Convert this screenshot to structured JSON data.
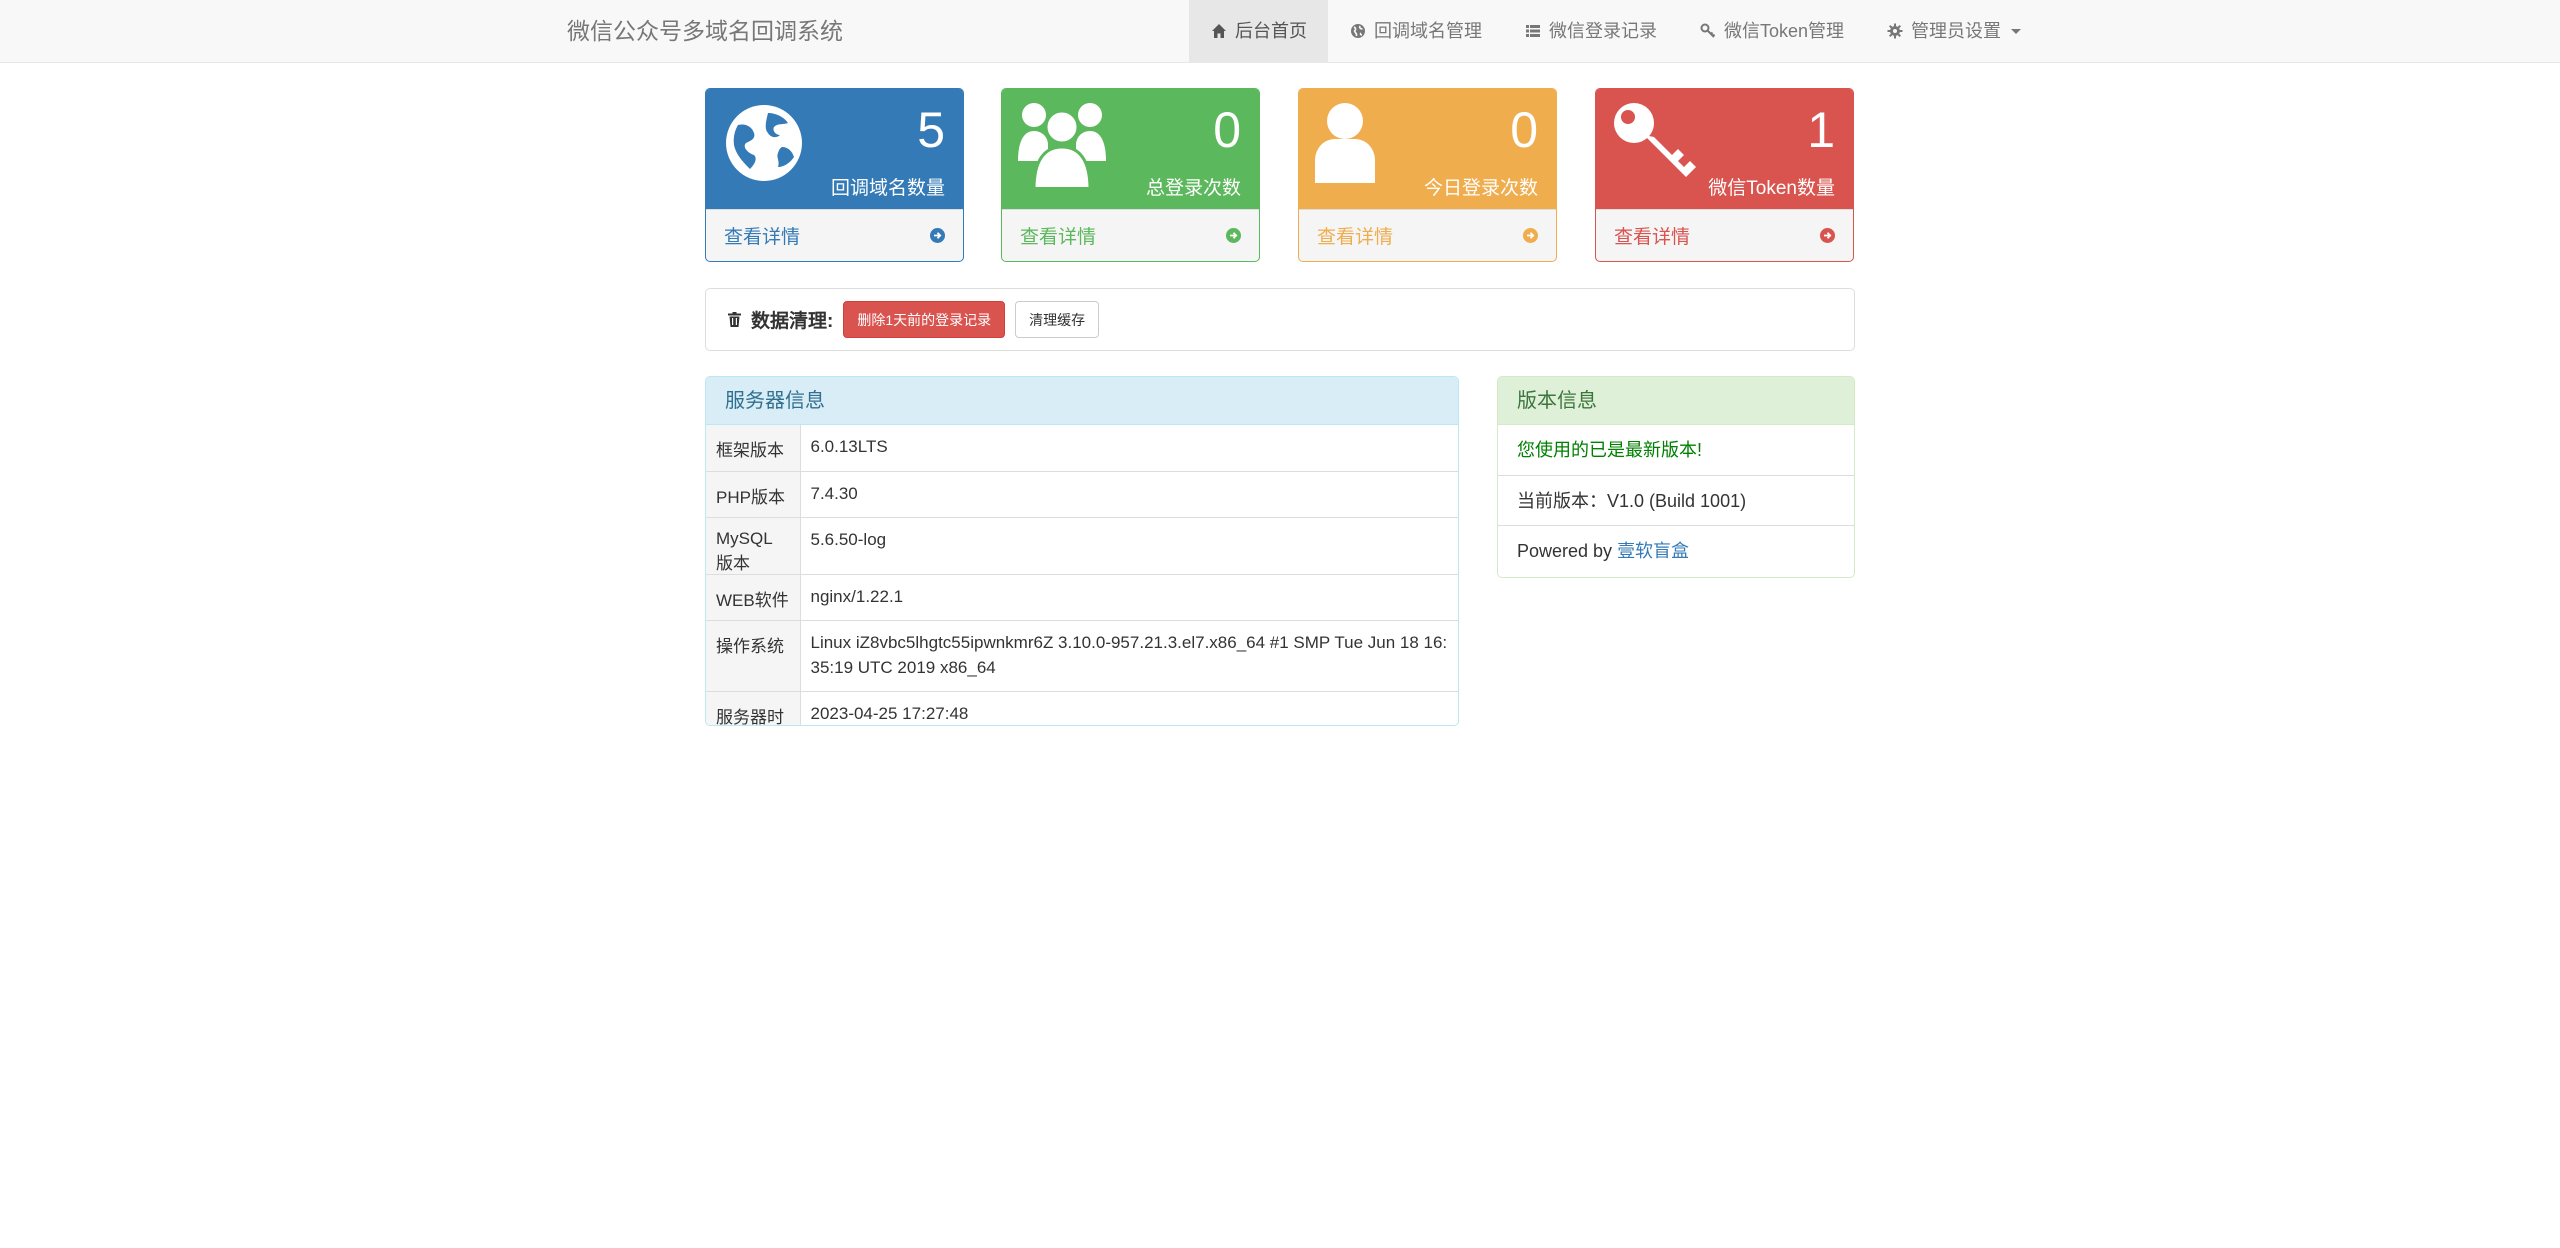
{
  "navbar": {
    "brand": "微信公众号多域名回调系统",
    "items": [
      {
        "label": "后台首页",
        "icon": "home-icon"
      },
      {
        "label": "回调域名管理",
        "icon": "globe-icon"
      },
      {
        "label": "微信登录记录",
        "icon": "list-icon"
      },
      {
        "label": "微信Token管理",
        "icon": "key-icon"
      },
      {
        "label": "管理员设置",
        "icon": "gear-icon"
      }
    ]
  },
  "stats": [
    {
      "value": "5",
      "label": "回调域名数量",
      "link": "查看详情",
      "icon": "globe-icon",
      "color": "#337ab7"
    },
    {
      "value": "0",
      "label": "总登录次数",
      "link": "查看详情",
      "icon": "users-icon",
      "color": "#5cb85c"
    },
    {
      "value": "0",
      "label": "今日登录次数",
      "link": "查看详情",
      "icon": "user-icon",
      "color": "#f0ad4e"
    },
    {
      "value": "1",
      "label": "微信Token数量",
      "link": "查看详情",
      "icon": "key-icon",
      "color": "#d9534f"
    }
  ],
  "clean": {
    "title": "数据清理:",
    "delete_button": "删除1天前的登录记录",
    "cache_button": "清理缓存"
  },
  "server": {
    "title": "服务器信息",
    "rows": [
      {
        "key": "框架版本",
        "value": "6.0.13LTS"
      },
      {
        "key": "PHP版本",
        "value": "7.4.30"
      },
      {
        "key": "MySQL版本",
        "value": "5.6.50-log"
      },
      {
        "key": "WEB软件",
        "value": "nginx/1.22.1"
      },
      {
        "key": "操作系统",
        "value": "Linux iZ8vbc5lhgtc55ipwnkmr6Z 3.10.0-957.21.3.el7.x86_64 #1 SMP Tue Jun 18 16:35:19 UTC 2019 x86_64"
      },
      {
        "key": "服务器时间",
        "value": "2023-04-25 17:27:48"
      }
    ]
  },
  "version": {
    "title": "版本信息",
    "latest": "您使用的已是最新版本!",
    "current": "当前版本：V1.0 (Build 1001)",
    "powered_prefix": "Powered by ",
    "powered_link": "壹软盲盒"
  }
}
